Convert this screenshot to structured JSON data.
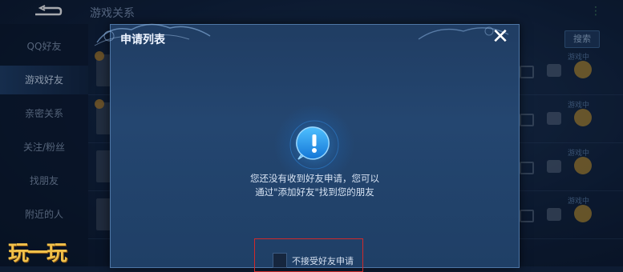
{
  "topbar": {
    "title": "游戏关系",
    "more": "⋮"
  },
  "sidebar": {
    "items": [
      {
        "label": "QQ好友"
      },
      {
        "label": "游戏好友"
      },
      {
        "label": "亲密关系"
      },
      {
        "label": "关注/粉丝"
      },
      {
        "label": "找朋友"
      },
      {
        "label": "附近的人"
      }
    ]
  },
  "search": {
    "label": "搜索"
  },
  "friends": [
    {
      "status": "游戏中"
    },
    {
      "status": "游戏中"
    },
    {
      "status": "游戏中"
    },
    {
      "status": "游戏中"
    }
  ],
  "modal": {
    "title": "申请列表",
    "close_glyph": "✕",
    "empty_line1": "您还没有收到好友申请，您可以",
    "empty_line2": "通过\"添加好友\"找到您的朋友",
    "reject_label": "不接受好友申请"
  },
  "watermark": {
    "text": "玩一玩"
  },
  "colors": {
    "accent": "#1d8fe8",
    "highlight_border": "#d02a2a",
    "watermark": "#f2c14a"
  }
}
